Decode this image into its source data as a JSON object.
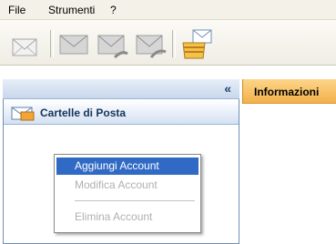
{
  "menubar": {
    "items": [
      "File",
      "Strumenti",
      "?"
    ]
  },
  "toolbar": {
    "buttons": [
      "new-message-icon",
      "send-mail-icon",
      "reply-icon",
      "forward-icon",
      "inbox-tray-icon"
    ]
  },
  "left_pane": {
    "collapse_label": "«",
    "folders_title": "Cartelle di Posta"
  },
  "right_pane": {
    "tab_label": "Informazioni"
  },
  "context_menu": {
    "items": [
      {
        "label": "Aggiungi Account",
        "state": "highlighted"
      },
      {
        "label": "Modifica Account",
        "state": "disabled"
      },
      {
        "label": "Elimina Account",
        "state": "disabled"
      }
    ]
  },
  "colors": {
    "highlight": "#316ac5",
    "accent_tab": "#f3b04a",
    "pane_header": "#c8d7ec"
  }
}
